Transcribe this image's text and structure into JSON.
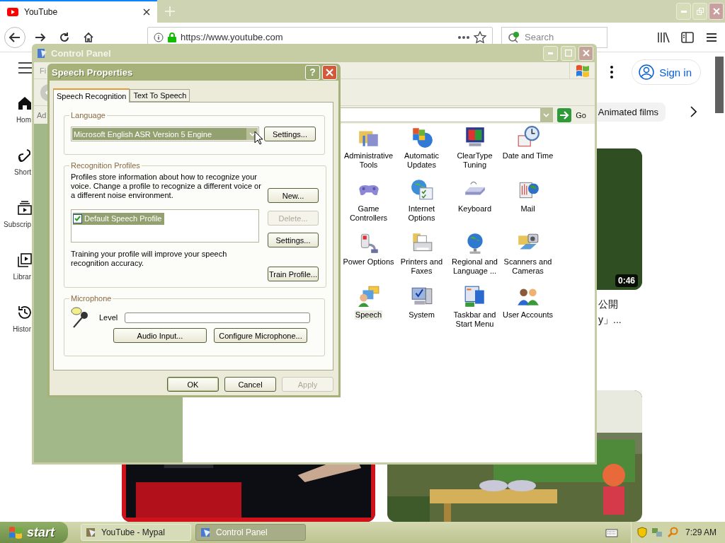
{
  "browser": {
    "tabs": [
      {
        "title": "YouTube",
        "selected": true
      }
    ],
    "address": "https://www.youtube.com",
    "search": {
      "placeholder": "Search"
    }
  },
  "youtube": {
    "sidebar": [
      {
        "label": "Hom"
      },
      {
        "label": "Short"
      },
      {
        "label": "Subscrip"
      },
      {
        "label": "Librar"
      },
      {
        "label": "Histor"
      }
    ],
    "sign_in": "Sign in",
    "chips": [
      "Animated films"
    ],
    "videos": [
      {
        "duration": "0:46",
        "title_lines": [
          "公開",
          "y」..."
        ]
      }
    ]
  },
  "control_panel": {
    "title": "Control Panel",
    "menu": [
      "Fi"
    ],
    "address_label": "Ad",
    "go": "Go",
    "items": [
      {
        "label": "Administrative Tools",
        "selected": false
      },
      {
        "label": "Automatic Updates",
        "selected": false
      },
      {
        "label": "ClearType Tuning",
        "selected": false
      },
      {
        "label": "Date and Time",
        "selected": false
      },
      {
        "label": "Game Controllers",
        "selected": false
      },
      {
        "label": "Internet Options",
        "selected": false
      },
      {
        "label": "Keyboard",
        "selected": false
      },
      {
        "label": "Mail",
        "selected": false
      },
      {
        "label": "Power Options",
        "selected": false
      },
      {
        "label": "Printers and Faxes",
        "selected": false
      },
      {
        "label": "Regional and Language ...",
        "selected": false
      },
      {
        "label": "Scanners and Cameras",
        "selected": false
      },
      {
        "label": "Speech",
        "selected": true
      },
      {
        "label": "System",
        "selected": false
      },
      {
        "label": "Taskbar and Start Menu",
        "selected": false
      },
      {
        "label": "User Accounts",
        "selected": false
      }
    ]
  },
  "dialog": {
    "title": "Speech Properties",
    "help": "?",
    "tabs": [
      {
        "label": "Speech Recognition",
        "selected": true
      },
      {
        "label": "Text To Speech",
        "selected": false
      }
    ],
    "language": {
      "legend": "Language",
      "engine": "Microsoft English ASR Version 5 Engine",
      "button": "Settings..."
    },
    "profiles": {
      "legend": "Recognition Profiles",
      "description": "Profiles store information about how to recognize your voice.  Change a profile to recognize a different voice or a different noise environment.",
      "list": [
        {
          "label": "Default Speech Profile",
          "checked": true,
          "selected": true
        }
      ],
      "buttons": [
        {
          "label": "New...",
          "disabled": false
        },
        {
          "label": "Delete...",
          "disabled": true
        },
        {
          "label": "Settings...",
          "disabled": false
        }
      ],
      "training_text": "Training your profile will improve your speech recognition accuracy.",
      "train_button": "Train Profile..."
    },
    "microphone": {
      "legend": "Microphone",
      "level_label": "Level",
      "level": 0,
      "buttons": [
        "Audio Input...",
        "Configure Microphone..."
      ]
    },
    "footer": [
      {
        "label": "OK",
        "disabled": false,
        "default": true
      },
      {
        "label": "Cancel",
        "disabled": false,
        "default": false
      },
      {
        "label": "Apply",
        "disabled": true,
        "default": false
      }
    ]
  },
  "taskbar": {
    "start": "start",
    "tasks": [
      {
        "label": "YouTube - Mypal",
        "selected": false
      },
      {
        "label": "Control Panel",
        "selected": true
      }
    ],
    "clock": "7:29 AM"
  }
}
